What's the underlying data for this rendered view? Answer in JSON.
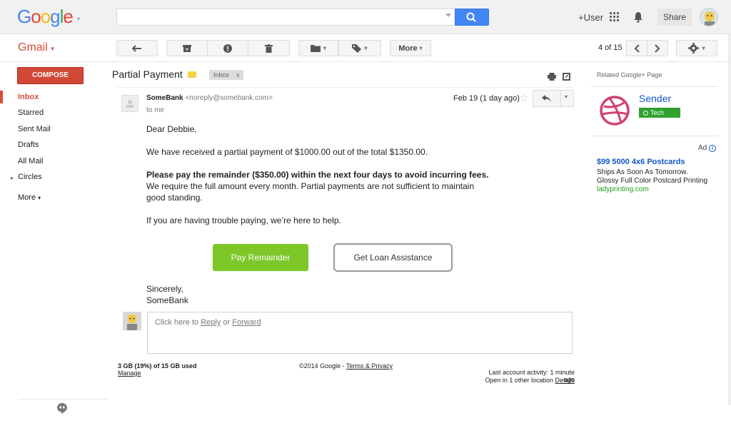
{
  "header": {
    "logo": "Google",
    "user_link": "+User",
    "share_label": "Share"
  },
  "toolbar": {
    "app_label": "Gmail",
    "more_label": "More",
    "pager": "4 of 15"
  },
  "nav": {
    "compose": "COMPOSE",
    "items": [
      {
        "label": "Inbox"
      },
      {
        "label": "Starred"
      },
      {
        "label": "Sent Mail"
      },
      {
        "label": "Drafts"
      },
      {
        "label": "All Mail"
      },
      {
        "label": "Circles"
      },
      {
        "label": "More"
      }
    ]
  },
  "message": {
    "subject": "Partial Payment",
    "tag": "Inbox",
    "tag_close": "x",
    "sender_name": "SomeBank",
    "sender_email": "<noreply@somebank.com>",
    "to": "to me",
    "date": "Feb 19 (1 day ago)",
    "greeting": "Dear Debbie,",
    "para1": "We have received a partial payment of $1000.00 out of the total $1350.00.",
    "para2_bold": "Please pay the remainder ($350.00) within the next four days to avoid incurring fees.",
    "para2_line2": "We require the full amount every month. Partial payments are not sufficient to maintain",
    "para2_line3": "good standing.",
    "para3": "If you are having trouble paying, we’re here to help.",
    "btn_pay": "Pay Remainder",
    "btn_loan": "Get Loan Assistance",
    "signoff": "Sincerely,",
    "signature": "SomeBank"
  },
  "reply": {
    "prefix": "Click here to ",
    "reply": "Reply",
    "or": " or ",
    "forward": "Forward"
  },
  "footer": {
    "storage": "3 GB (19%) of 15 GB used",
    "manage": "Manage",
    "copyright": "©2014 Google - ",
    "terms": "Terms & Privacy",
    "activity": "Last account activity: 1 minute ago",
    "open_in": "Open in 1 other location  ",
    "details": "Details"
  },
  "sidebar_right": {
    "related": "Related Google+ Page",
    "page_name": "Sender",
    "page_badge": "Tech",
    "ad_label": "Ad",
    "ad_title": "$99 5000 4x6 Postcards",
    "ad_line1": "Ships As Soon As Tomorrow.",
    "ad_line2": "Glossy Full Color Postcard Printing",
    "ad_url": "ladyprinting.com"
  },
  "colors": {
    "accent_red": "#dd4b39",
    "search_blue": "#4285f4",
    "pay_green": "#7dc728",
    "link_blue": "#1155cc"
  }
}
